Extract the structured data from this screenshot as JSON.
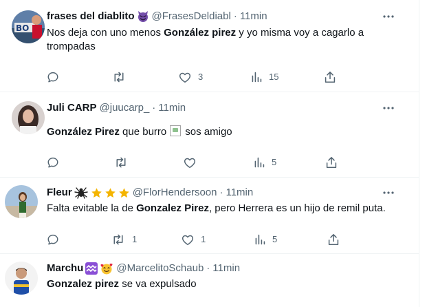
{
  "tweets": [
    {
      "name": "frases del diablito",
      "handle": "@FrasesDeldiabl",
      "time": "11min",
      "text_bold": "",
      "text_pre": "Nos deja con uno menos ",
      "text_bold_mid": "González pirez",
      "text_post": " y yo misma voy a cagarlo a",
      "text_line2": "trompadas",
      "replies": "",
      "retweets": "",
      "likes": "3",
      "views": "15"
    },
    {
      "name": "Juli CARP",
      "handle": "@juucarp_",
      "time": "11min",
      "text_bold": "González Pirez",
      "text_mid": " que burro",
      "text_post": "sos amigo",
      "replies": "",
      "retweets": "",
      "likes": "",
      "views": "5"
    },
    {
      "name": "Fleur",
      "handle": "@FlorHendersoon",
      "time": "11min",
      "text_pre": "Falta evitable la de ",
      "text_bold": "Gonzalez Pirez",
      "text_post": ", pero Herrera es un hijo de remil puta.",
      "replies": "",
      "retweets": "1",
      "likes": "1",
      "views": "5"
    },
    {
      "name": "Marchu",
      "handle": "@MarcelitoSchaub",
      "time": "11min",
      "text_bold": "Gonzalez pirez",
      "text_post": " se va expulsado"
    }
  ],
  "ui": {
    "separator": "·"
  },
  "icons": {
    "reply": "reply-icon",
    "retweet": "retweet-icon",
    "like": "heart-icon",
    "views": "views-icon",
    "share": "share-icon",
    "more": "more-icon",
    "devil": "devil-emoji-icon",
    "spider": "spider-emoji-icon",
    "star": "star-emoji-icon",
    "aquarius": "aquarius-emoji-icon",
    "hearts_face": "smiling-face-hearts-emoji-icon"
  },
  "colors": {
    "text": "#0f1419",
    "secondary": "#536471",
    "border": "#eff3f4",
    "star": "#f4b400",
    "aquarius": "#8a4fd6"
  }
}
